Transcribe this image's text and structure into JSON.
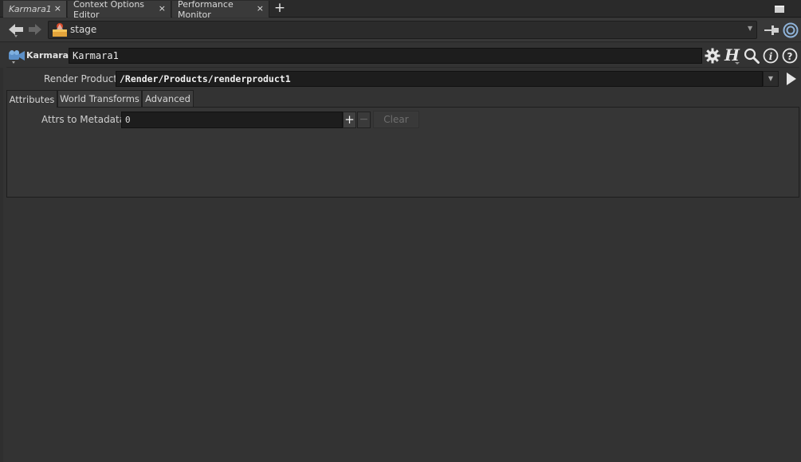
{
  "tabs": [
    {
      "label": "Karmara1",
      "close": "×",
      "active": true
    },
    {
      "label": "Context Options Editor",
      "close": "×",
      "active": false
    },
    {
      "label": "Performance Monitor",
      "close": "×",
      "active": false
    }
  ],
  "tab_add": "+",
  "path": {
    "label": "stage",
    "icon": "stage-icon"
  },
  "node": {
    "type_label": "Karmara",
    "name_value": "Karmara1",
    "icon": "karma-camera-icon"
  },
  "render_product": {
    "label": "Render Product",
    "value": "/Render/Products/renderproduct1"
  },
  "folder_tabs": [
    {
      "label": "Attributes",
      "active": true
    },
    {
      "label": "World Transforms",
      "active": false
    },
    {
      "label": "Advanced",
      "active": false
    }
  ],
  "attrs": {
    "label": "Attrs to Metadata",
    "value": "0",
    "plus": "+",
    "minus": "−",
    "clear": "Clear"
  },
  "colors": {
    "background": "#333333",
    "field": "#1d1d1d",
    "text": "#cfcfcf"
  }
}
